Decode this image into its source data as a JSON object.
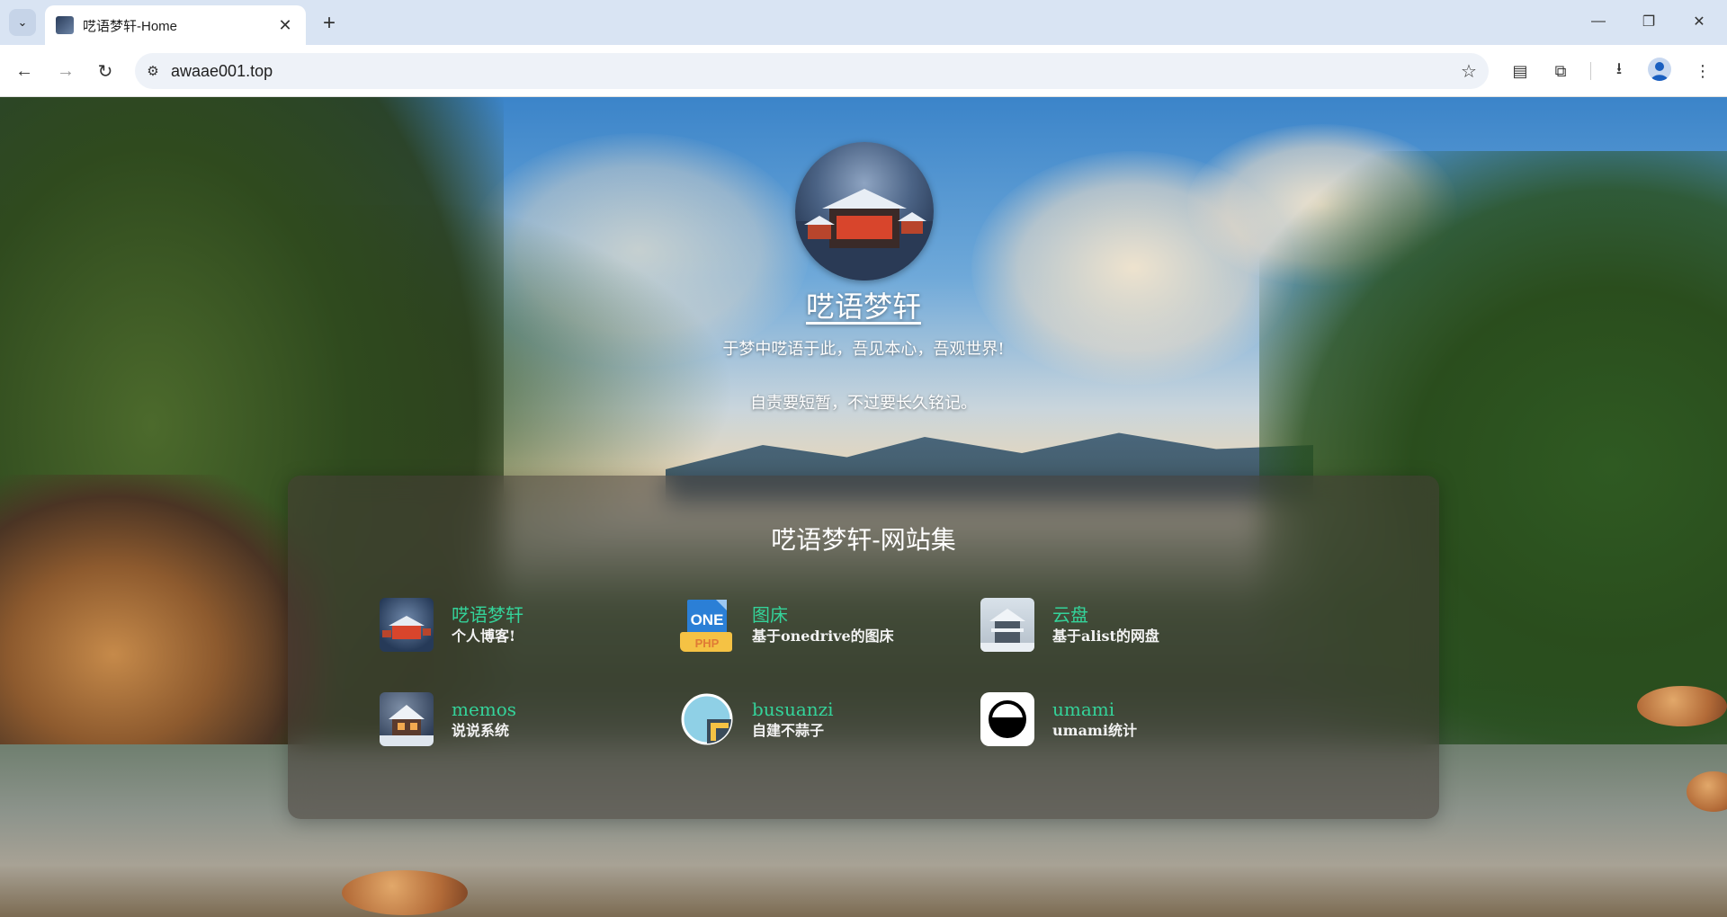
{
  "browser": {
    "tab_title": "呓语梦轩-Home",
    "url": "awaae001.top"
  },
  "header": {
    "title": "呓语梦轩",
    "subtitle1": "于梦中呓语于此，吾见本心，吾观世界!",
    "subtitle2": "自责要短暂，不过要长久铭记。"
  },
  "section": {
    "title": "呓语梦轩-网站集"
  },
  "sites": [
    {
      "name": "呓语梦轩",
      "desc": "个人博客!",
      "icon": "blog-thumbnail-icon"
    },
    {
      "name": "图床",
      "desc": "基于onedrive的图床",
      "icon": "onedrive-php-icon",
      "icon_label_top": "ONE",
      "icon_label_bottom": "PHP"
    },
    {
      "name": "云盘",
      "desc": "基于alist的网盘",
      "icon": "snow-temple-icon"
    },
    {
      "name": "memos",
      "desc": "说说系统",
      "icon": "winter-house-icon"
    },
    {
      "name": "busuanzi",
      "desc": "自建不蒜子",
      "icon": "pie-chart-icon"
    },
    {
      "name": "umami",
      "desc": "umami统计",
      "icon": "umami-logo-icon"
    }
  ],
  "colors": {
    "link_green": "#34d39a",
    "tab_bar": "#d9e4f3"
  }
}
